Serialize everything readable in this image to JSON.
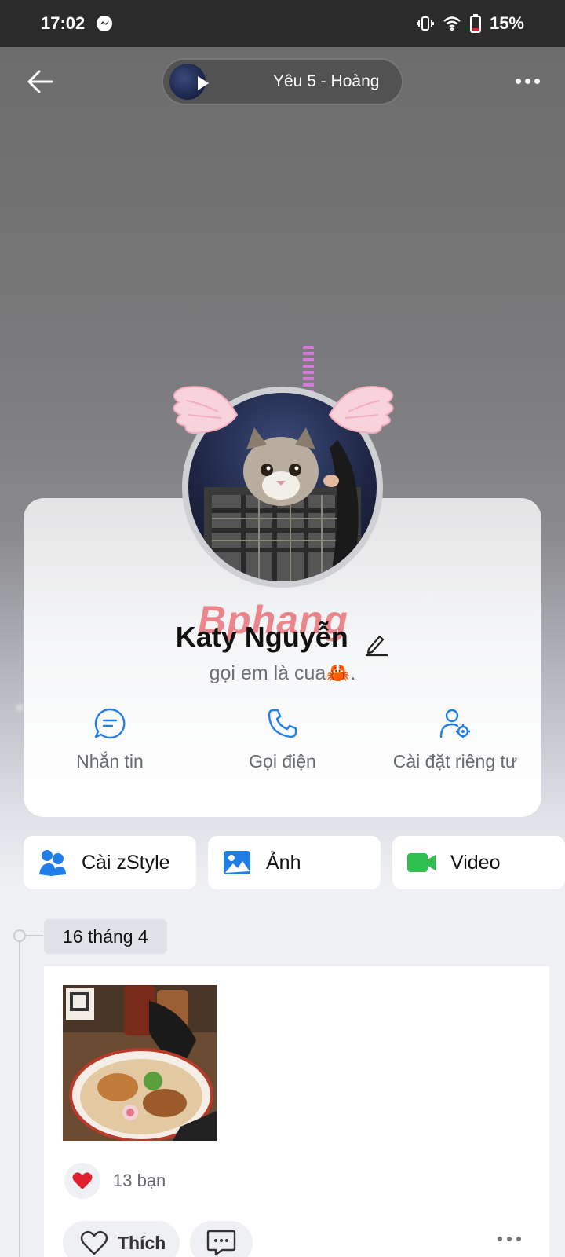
{
  "status_bar": {
    "time": "17:02",
    "battery": "15%"
  },
  "header": {
    "music_title": "Yêu 5 - Hoàng"
  },
  "profile": {
    "name": "Katy Nguyễn",
    "status": "gọi em là cua🦀.",
    "watermark": "Bphang"
  },
  "actions": [
    {
      "label": "Nhắn tin",
      "icon": "message-icon"
    },
    {
      "label": "Gọi điện",
      "icon": "phone-icon"
    },
    {
      "label": "Cài đặt riêng tư",
      "icon": "user-settings-icon"
    }
  ],
  "chips": [
    {
      "label": "Cài zStyle",
      "icon": "zstyle-icon"
    },
    {
      "label": "Ảnh",
      "icon": "photo-icon"
    },
    {
      "label": "Video",
      "icon": "video-icon"
    }
  ],
  "timeline": {
    "date": "16 tháng 4",
    "post": {
      "likes_text": "13 bạn",
      "like_label": "Thích"
    }
  },
  "colors": {
    "accent": "#1f7ee8",
    "video_green": "#2fbf4f",
    "heart_red": "#e0202e"
  }
}
